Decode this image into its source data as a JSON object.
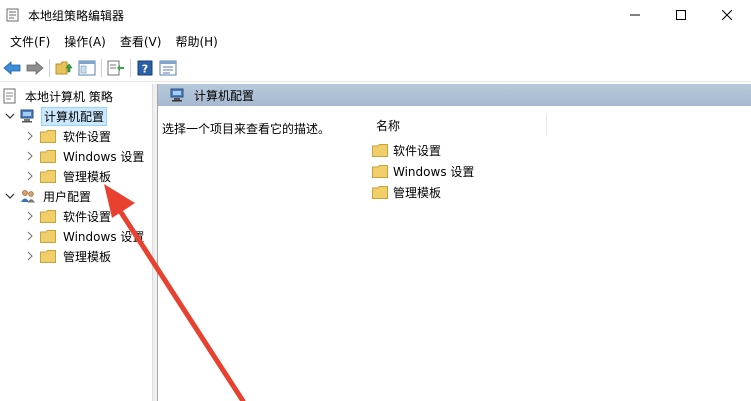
{
  "window": {
    "title": "本地组策略编辑器"
  },
  "menu": [
    "文件(F)",
    "操作(A)",
    "查看(V)",
    "帮助(H)"
  ],
  "toolbar": {
    "buttons": [
      "back-icon",
      "forward-icon",
      "up-folder-icon",
      "show-hide-tree-icon",
      "export-list-icon",
      "help-icon",
      "properties-icon"
    ]
  },
  "tree": {
    "root": "本地计算机 策略",
    "computer_config": "计算机配置",
    "computer_children": [
      "软件设置",
      "Windows 设置",
      "管理模板"
    ],
    "user_config": "用户配置",
    "user_children": [
      "软件设置",
      "Windows 设置",
      "管理模板"
    ]
  },
  "right": {
    "header": "计算机配置",
    "description": "选择一个项目来查看它的描述。",
    "column_name": "名称",
    "items": [
      "软件设置",
      "Windows 设置",
      "管理模板"
    ]
  },
  "colors": {
    "selection": "#cce8ff",
    "header_bg": "#b8c9dc",
    "folder": "#e8c15a",
    "arrow": "#e8412f"
  }
}
